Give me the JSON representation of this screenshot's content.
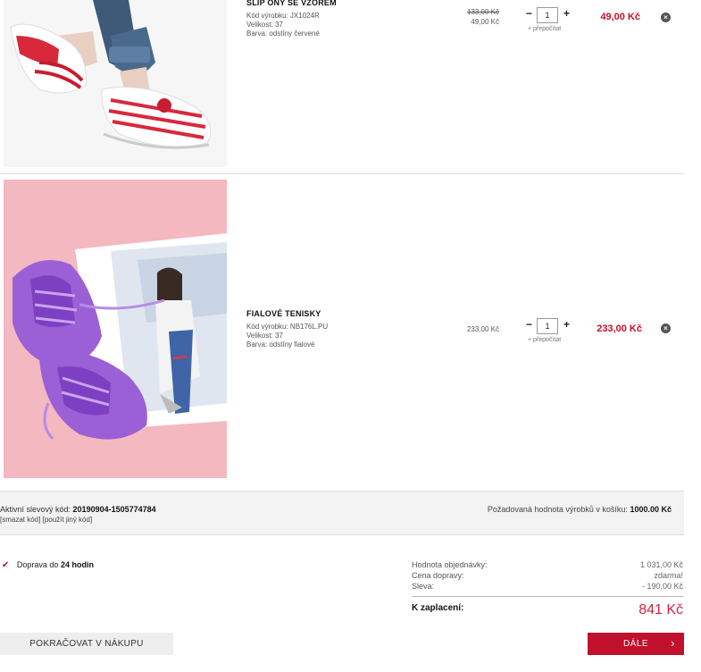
{
  "items": [
    {
      "name": "SLIP ONY SE VZOREM",
      "code": "Kód výrobku: JX1024R",
      "size": "Velikost: 37",
      "color": "Barva: odstíny červené",
      "unit_price_old": "133,00 Kč",
      "unit_price": "49,00 Kč",
      "qty": "1",
      "recalc": "+ přepočítat",
      "total": "49,00 Kč",
      "remove_icon": "×"
    },
    {
      "name": "FIALOVÉ TENISKY",
      "code": "Kód výrobku: NB176L.PU",
      "size": "Velikost: 37",
      "color": "Barva: odstíny fialové",
      "unit_price": "233,00 Kč",
      "qty": "1",
      "recalc": "+ přepočítat",
      "total": "233,00 Kč",
      "remove_icon": "×"
    }
  ],
  "qty_controls": {
    "minus": "−",
    "plus": "+"
  },
  "coupon": {
    "label": "Aktivní slevový kód:",
    "code": "20190904-1505774784",
    "delete_link": "[smazat kód]",
    "other_link": "[použít jiný kód]",
    "required_label": "Požadovaná hodnota výrobků v košíku:",
    "required_value": "1000.00 Kč"
  },
  "delivery": {
    "check_icon": "✔",
    "prefix": "Doprava do",
    "time": "24 hodin"
  },
  "summary": {
    "order_value_label": "Hodnota objednávky:",
    "order_value": "1 031,00 Kč",
    "shipping_label": "Cena dopravy:",
    "shipping_value": "zdarma!",
    "discount_label": "Sleva:",
    "discount_value": "- 190,00 Kč",
    "total_label": "K zaplacení:",
    "total_value": "841 Kč"
  },
  "buttons": {
    "continue": "POKRAČOVAT V NÁKUPU",
    "next": "DÁLE",
    "next_arrow": "›"
  },
  "colors": {
    "accent": "#c0102c",
    "price_red": "#d0243f",
    "item1_bg": "#f4f4f4",
    "item2_bg": "#f4b5bd"
  }
}
